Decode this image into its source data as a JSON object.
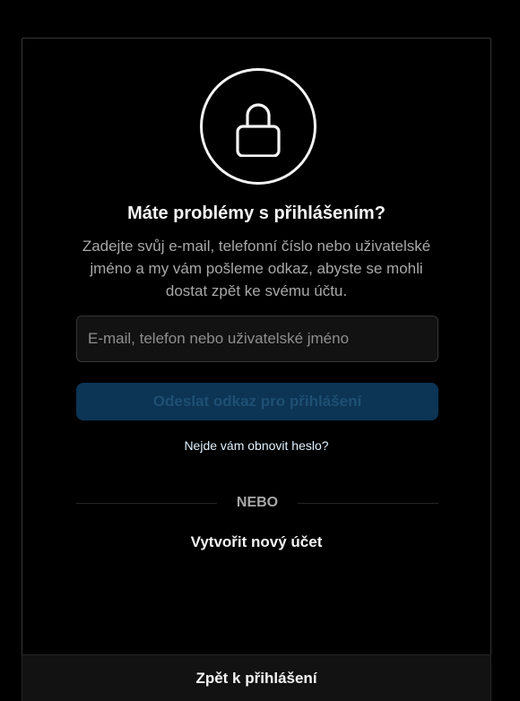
{
  "reset": {
    "title": "Máte problémy s přihlášením?",
    "description": "Zadejte svůj e-mail, telefonní číslo nebo uživatelské jméno a my vám pošleme odkaz, abyste se mohli dostat zpět ke svému účtu.",
    "input_placeholder": "E-mail, telefon nebo uživatelské jméno",
    "input_value": "",
    "submit_label": "Odeslat odkaz pro přihlášení",
    "forgot_link": "Nejde vám obnovit heslo?",
    "divider_label": "NEBO",
    "create_account_link": "Vytvořit nový účet",
    "back_to_login": "Zpět k přihlášení"
  },
  "icons": {
    "hero": "lock-icon"
  },
  "colors": {
    "background": "#000000",
    "text_primary": "#f5f5f5",
    "text_secondary": "#a8a8a8",
    "button_disabled_bg": "#0c3454",
    "button_disabled_text": "#1f4f73",
    "link": "#e0f1ff"
  }
}
